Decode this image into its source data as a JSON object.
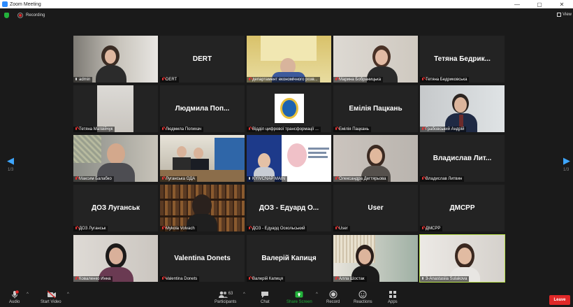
{
  "window": {
    "title": "Zoom Meeting",
    "min": "—",
    "max": "▢",
    "close": "✕"
  },
  "topbar": {
    "recording": "Recording",
    "view": "View"
  },
  "nav": {
    "prev_page": "1/3",
    "next_page": "1/3"
  },
  "participants": [
    {
      "label": "admin",
      "video": true,
      "mic_on": true
    },
    {
      "label": "DERT",
      "display": "DERT",
      "video": false
    },
    {
      "label": "департамент економічного розв...",
      "video": true
    },
    {
      "label": "Марина Бобраницька",
      "video": true
    },
    {
      "label": "Тетяна Бедриковська",
      "display": "Тетяна Бедрик...",
      "video": false
    },
    {
      "label": "Тетяна Матвійчук",
      "video": true
    },
    {
      "label": "Людмила Попихач",
      "display": "Людмила Поп...",
      "video": false
    },
    {
      "label": "Відділ цифрової трансформації ...",
      "video": true
    },
    {
      "label": "Емілія Пацкань",
      "display": "Емілія Пацкань",
      "video": false
    },
    {
      "label": "Грабовський Андрій",
      "video": true
    },
    {
      "label": "Максим Балабко",
      "video": true
    },
    {
      "label": "Луганська ОДА",
      "video": true
    },
    {
      "label": "KYIVCNAP MAIN",
      "video": true,
      "mic_on": true
    },
    {
      "label": "Олександра Дегтярьова",
      "video": true
    },
    {
      "label": "Владислав Литвин",
      "display": "Владислав Лит...",
      "video": false
    },
    {
      "label": "ДОЗ Луганськ",
      "display": "ДОЗ Луганськ",
      "video": false
    },
    {
      "label": "Mykola Volvach",
      "video": true
    },
    {
      "label": "ДОЗ - Едуард Оскольський",
      "display": "ДОЗ - Едуард О...",
      "video": false
    },
    {
      "label": "User",
      "display": "User",
      "video": false
    },
    {
      "label": "ДМСРР",
      "display": "ДМСРР",
      "video": false
    },
    {
      "label": "Коваленко Инна",
      "video": true
    },
    {
      "label": "Valentina Donets",
      "display": "Valentina Donets",
      "video": false
    },
    {
      "label": "Валерій Капиця",
      "display": "Валерій Капиця",
      "video": false
    },
    {
      "label": "Алла Шостак",
      "video": true
    },
    {
      "label": "3-Anastasiia Sulakova",
      "video": true,
      "mic_on": true,
      "active": true
    }
  ],
  "toolbar": {
    "audio": "Audio",
    "start_video": "Start Video",
    "participants": "Participants",
    "participants_count": "63",
    "chat": "Chat",
    "share_screen": "Share Screen",
    "record": "Record",
    "reactions": "Reactions",
    "apps": "Apps",
    "leave": "Leave"
  },
  "colors": {
    "accent": "#2d8cff",
    "share": "#23b23b",
    "leave": "#e02828",
    "active_speaker": "#b8e04a"
  }
}
